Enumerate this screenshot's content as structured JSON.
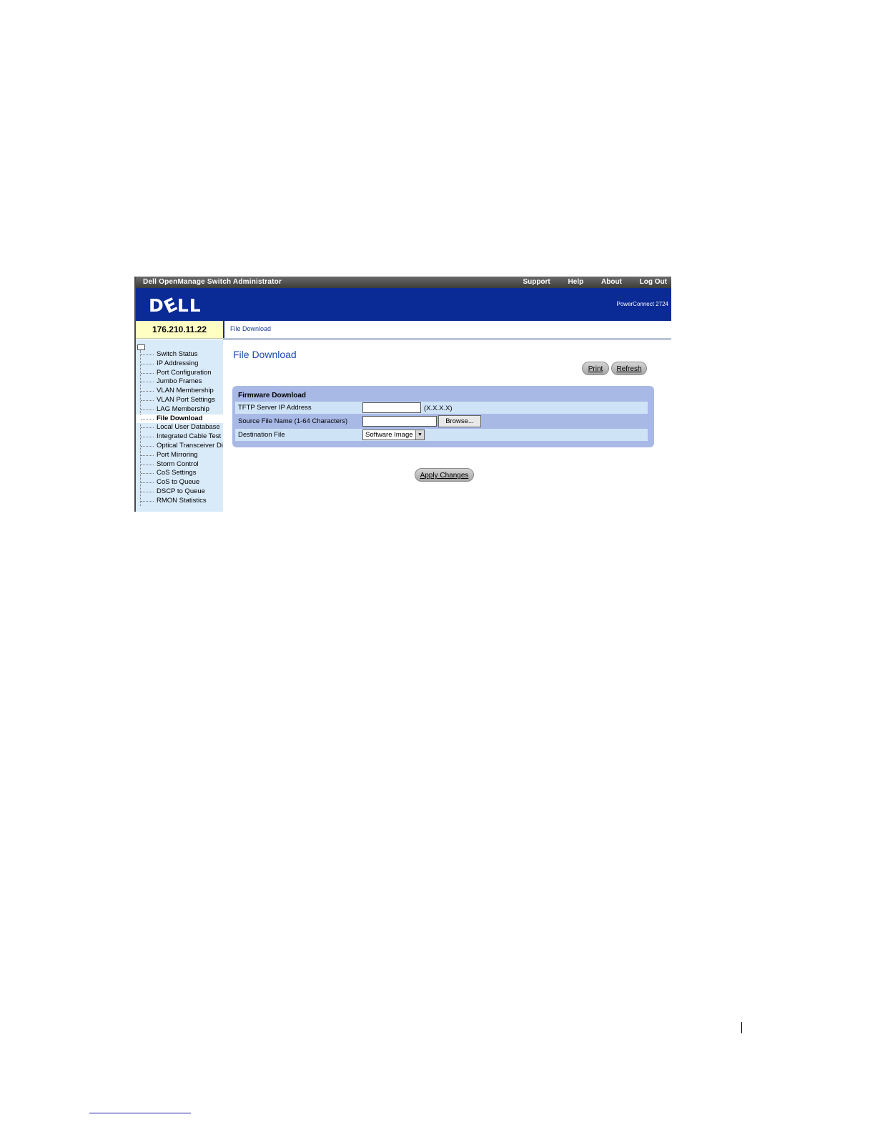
{
  "topbar": {
    "title": "Dell OpenManage Switch Administrator",
    "links": [
      "Support",
      "Help",
      "About",
      "Log Out"
    ]
  },
  "banner": {
    "logo": [
      "D",
      "E",
      "LL"
    ],
    "model": "PowerConnect 2724"
  },
  "ip_address": "176.210.11.22",
  "breadcrumb": "File Download",
  "sidebar": {
    "items": [
      "Switch Status",
      "IP Addressing",
      "Port Configuration",
      "Jumbo Frames",
      "VLAN Membership",
      "VLAN Port Settings",
      "LAG Membership",
      "File Download",
      "Local User Database",
      "Integrated Cable Test",
      "Optical Transceiver Dia",
      "Port Mirroring",
      "Storm Control",
      "CoS Settings",
      "CoS to Queue",
      "DSCP to Queue",
      "RMON Statistics"
    ],
    "active_item": "File Download"
  },
  "main": {
    "title": "File Download",
    "print_label": "Print",
    "refresh_label": "Refresh",
    "panel_title": "Firmware Download",
    "tftp_label": "TFTP Server IP Address",
    "tftp_value": "",
    "tftp_hint": "(X.X.X.X)",
    "source_label": "Source File Name (1-64 Characters)",
    "source_value": "",
    "browse_label": "Browse...",
    "dest_label": "Destination File",
    "dest_value": "Software Image",
    "apply_label": "Apply Changes"
  }
}
